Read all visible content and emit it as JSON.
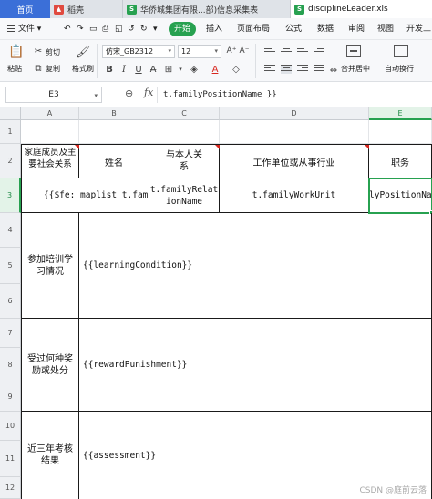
{
  "tabs": [
    {
      "label": "首页",
      "icon": "home-icon"
    },
    {
      "label": "稻壳",
      "icon": "docer-icon"
    },
    {
      "label": "华侨城集团有限...部)信息采集表",
      "icon": "spreadsheet-icon"
    },
    {
      "label": "disciplineLeader.xls",
      "icon": "spreadsheet-icon"
    }
  ],
  "menu": {
    "file": "文件",
    "start": "开始",
    "insert": "插入",
    "layout": "页面布局",
    "formula": "公式",
    "data": "数据",
    "review": "审阅",
    "view": "视图",
    "dev": "开发工"
  },
  "toolbar": {
    "cut": "剪切",
    "paste": "粘贴",
    "copy": "复制",
    "format_painter": "格式刷",
    "font_name": "仿宋_GB2312",
    "font_size": "12",
    "merge_center": "合并居中",
    "wrap": "自动换行",
    "bold": "B",
    "italic": "I",
    "underline": "U",
    "font_color_letter": "A"
  },
  "formula_bar": {
    "cell_ref": "E3",
    "fx": "fx",
    "content": "t.familyPositionName }}"
  },
  "columns": [
    "A",
    "B",
    "C",
    "D",
    "E"
  ],
  "rows": [
    "1",
    "2",
    "3",
    "4",
    "5",
    "6",
    "7",
    "8",
    "9",
    "10",
    "11",
    "12"
  ],
  "cells": {
    "a2": "家庭成员及主要社会关系",
    "b2": "姓名",
    "c2": "与本人关系",
    "d2": "工作单位或从事行业",
    "e2": "职务",
    "ab3": "{{$fe: maplist t.fam",
    "c3": "t.familyRelationName",
    "d3": "t.familyWorkUnit",
    "e3": "lyPositionNa",
    "a5": "参加培训学习情况",
    "b5": "{{learningCondition}}",
    "a8": "受过何种奖励或处分",
    "b8": "{{rewardPunishment}}",
    "a11": "近三年考核结果",
    "b11": "{{assessment}}"
  },
  "watermark": "CSDN @庭前云落"
}
